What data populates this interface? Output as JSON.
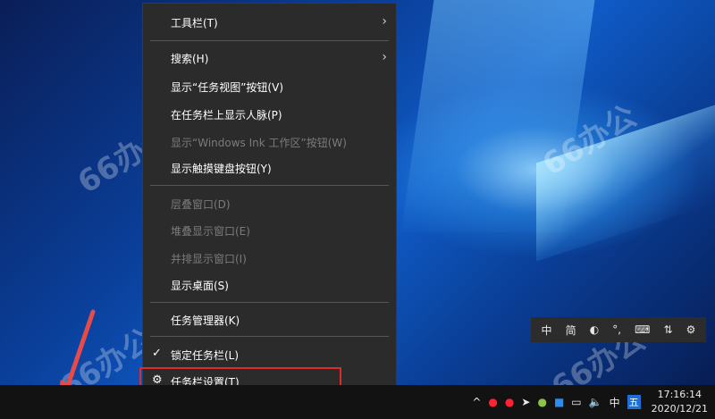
{
  "context_menu": {
    "items": [
      {
        "label": "工具栏(T)",
        "disabled": false,
        "submenu": true
      },
      {
        "label": "搜索(H)",
        "disabled": false,
        "submenu": true
      },
      {
        "label": "显示“任务视图”按钮(V)",
        "disabled": false
      },
      {
        "label": "在任务栏上显示人脉(P)",
        "disabled": false
      },
      {
        "label": "显示“Windows Ink 工作区”按钮(W)",
        "disabled": true
      },
      {
        "label": "显示触摸键盘按钮(Y)",
        "disabled": false
      },
      {
        "label": "层叠窗口(D)",
        "disabled": true
      },
      {
        "label": "堆叠显示窗口(E)",
        "disabled": true
      },
      {
        "label": "并排显示窗口(I)",
        "disabled": true
      },
      {
        "label": "显示桌面(S)",
        "disabled": false
      },
      {
        "label": "任务管理器(K)",
        "disabled": false
      },
      {
        "label": "锁定任务栏(L)",
        "disabled": false,
        "checked": true
      },
      {
        "label": "任务栏设置(T)",
        "disabled": false,
        "icon": "gear-icon",
        "highlighted": true
      }
    ]
  },
  "ime_toolbar": {
    "items": [
      "中",
      "简",
      "moon-icon",
      "°,",
      "keyboard-icon",
      "toolbox-icon",
      "gear-icon"
    ],
    "labels": {
      "chinese": "中",
      "simplified": "简",
      "punct": "°,"
    }
  },
  "tray": {
    "input_lang": "中",
    "ime": "五",
    "time": "17:16:14",
    "date": "2020/12/21"
  },
  "watermark": {
    "text": "66办公"
  },
  "colors": {
    "menu_bg": "#2b2b2b",
    "highlight_border": "#e02a2a",
    "taskbar_bg": "#121212",
    "ime_badge": "#1d6fd4"
  }
}
